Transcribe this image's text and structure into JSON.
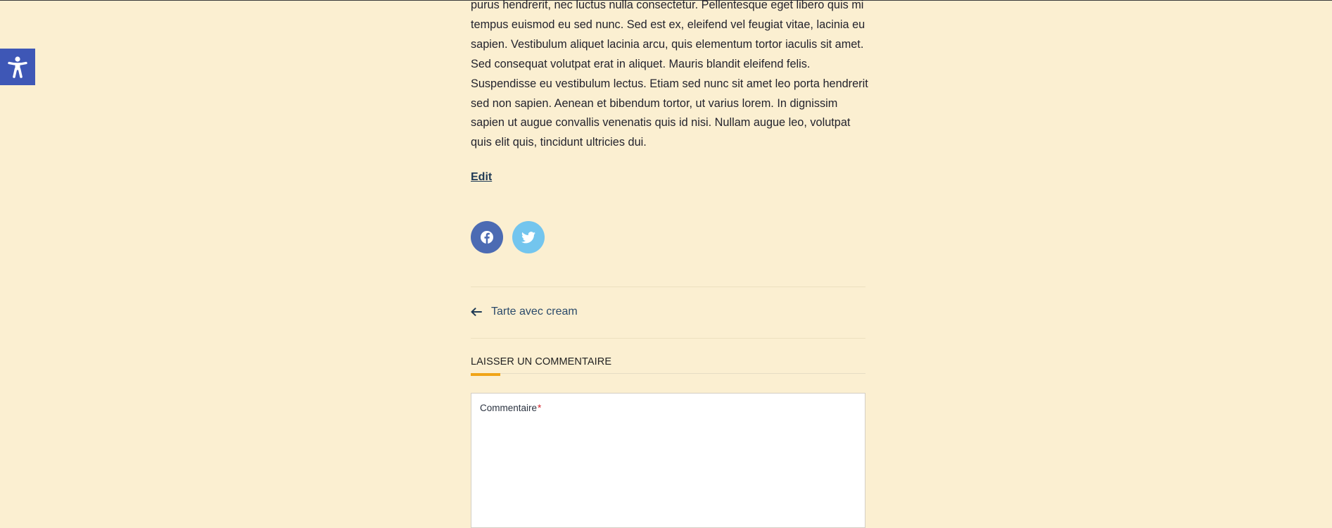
{
  "article": {
    "body": "purus hendrerit, nec luctus nulla consectetur. Pellentesque eget libero quis mi tempus euismod eu sed nunc. Sed est ex, eleifend vel feugiat vitae, lacinia eu sapien. Vestibulum aliquet lacinia arcu, quis elementum tortor iaculis sit amet. Sed consequat volutpat erat in aliquet. Mauris blandit eleifend felis. Suspendisse eu vestibulum lectus. Etiam sed nunc sit amet leo porta hendrerit sed non sapien. Aenean et bibendum tortor, ut varius lorem. In dignissim sapien ut augue convallis venenatis quis id nisi. Nullam augue leo, volutpat quis elit quis, tincidunt ultricies dui.",
    "edit_label": "Edit"
  },
  "share": {
    "facebook_icon": "facebook-icon",
    "twitter_icon": "twitter-icon",
    "facebook_color": "#4c6bb3",
    "twitter_color": "#73c5ee"
  },
  "navigation": {
    "previous_label": "Tarte avec cream",
    "previous_icon": "arrow-left-icon"
  },
  "comments": {
    "heading": "LAISSER UN COMMENTAIRE",
    "field_label": "Commentaire",
    "required_marker": "*",
    "accent_color": "#f0a417"
  },
  "accessibility": {
    "icon": "accessibility-icon",
    "color": "#3e57b6"
  }
}
